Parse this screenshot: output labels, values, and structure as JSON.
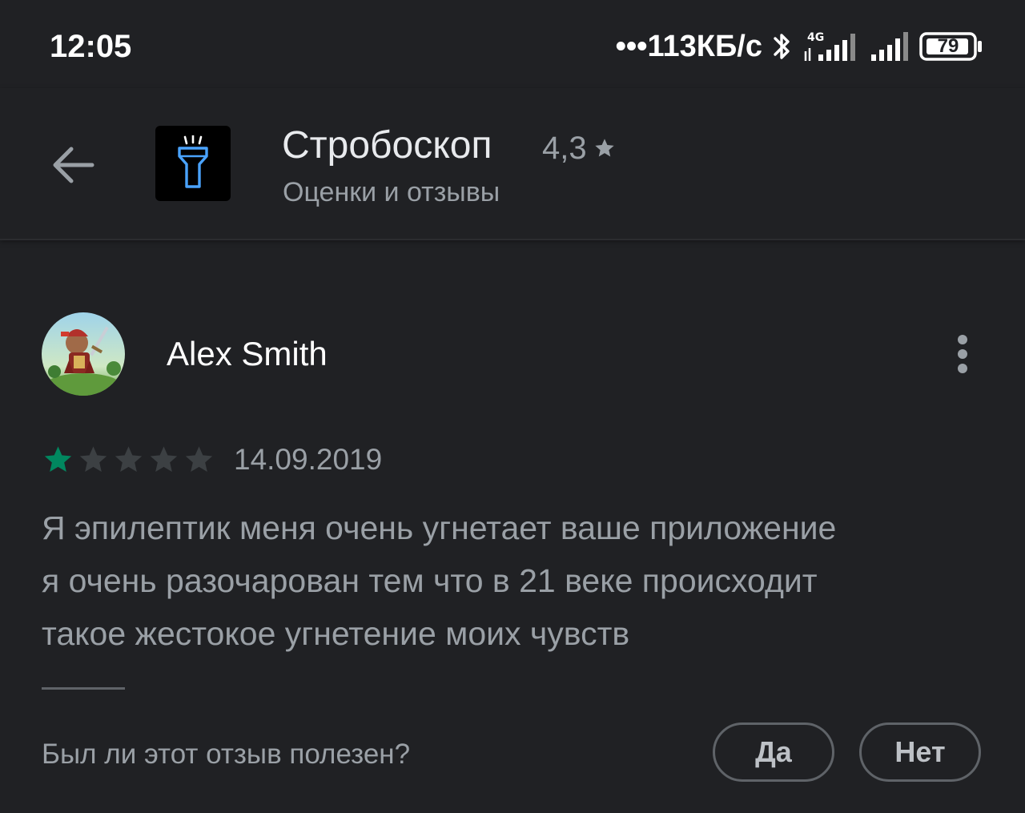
{
  "status_bar": {
    "time": "12:05",
    "net_speed": "•••113КБ/с",
    "network_type": "4G",
    "battery_level": "79",
    "icons": [
      "bluetooth-icon",
      "signal-4g-icon",
      "signal-icon",
      "battery-icon"
    ]
  },
  "header": {
    "back_icon": "arrow-left-icon",
    "app_icon": "flashlight-icon",
    "app_title": "Стробоскоп",
    "rating": "4,3",
    "rating_icon": "star-icon",
    "subtitle": "Оценки и отзывы"
  },
  "review": {
    "author": "Alex Smith",
    "avatar": "avatar-knight-image",
    "menu_icon": "more-vertical-icon",
    "rating": 1,
    "max_rating": 5,
    "date": "14.09.2019",
    "body_lines": [
      "Я эпилептик меня очень угнетает ваше приложение",
      "я очень разочарован тем что в 21 веке происходит",
      "такое жестокое угнетение моих чувств"
    ]
  },
  "feedback": {
    "question": "Был ли этот отзыв полезен?",
    "yes_label": "Да",
    "no_label": "Нет"
  },
  "colors": {
    "background": "#202124",
    "star_filled": "#01875f",
    "star_empty": "#3c4043",
    "text_secondary": "#9aa0a6",
    "app_icon_outline": "#4aa3ff"
  }
}
